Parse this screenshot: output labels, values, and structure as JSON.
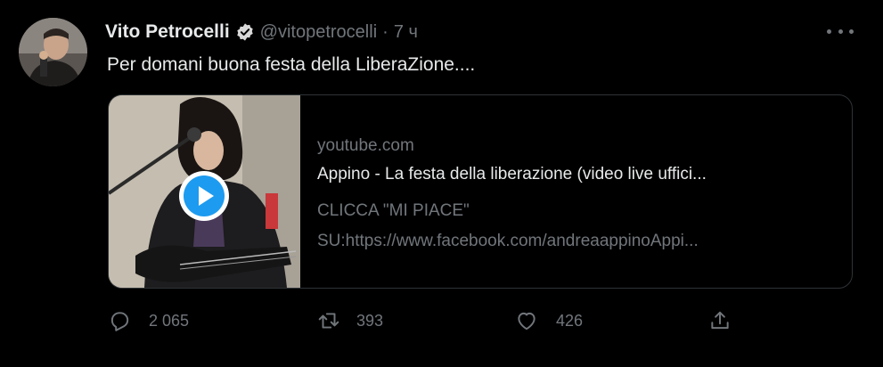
{
  "tweet": {
    "author_name": "Vito Petrocelli",
    "handle": "@vitopetrocelli",
    "separator": "·",
    "time": "7 ч",
    "text": "Per domani buona festa della LiberaZione....",
    "verified": true
  },
  "card": {
    "domain": "youtube.com",
    "title": "Appino - La festa della liberazione (video live uffici...",
    "description_line1": "CLICCA \"MI PIACE\"",
    "description_line2": "SU:https://www.facebook.com/andreaappinoAppi..."
  },
  "actions": {
    "reply_count": "2 065",
    "retweet_count": "393",
    "like_count": "426"
  },
  "icons": [
    "verified-badge-icon",
    "more-icon",
    "play-icon",
    "reply-icon",
    "retweet-icon",
    "like-icon",
    "share-icon"
  ],
  "colors": {
    "background": "#000000",
    "text": "#e7e9ea",
    "muted": "#71767b",
    "border": "#2f3336",
    "play": "#1d9bf0"
  }
}
